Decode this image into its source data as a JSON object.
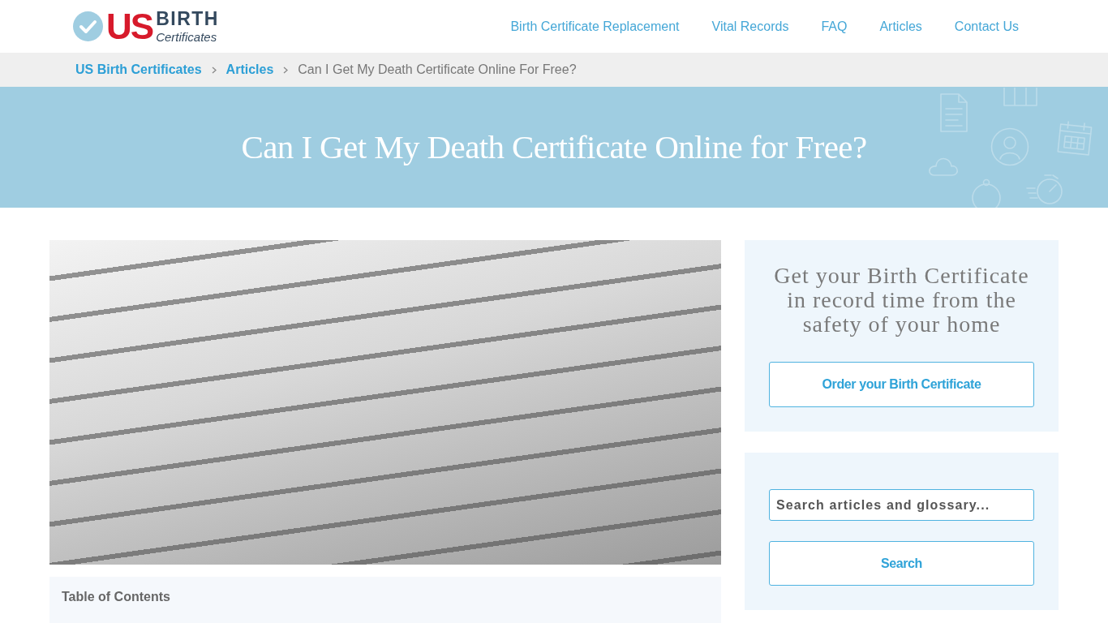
{
  "header": {
    "logo": {
      "mark": "US",
      "word": "BIRTH",
      "tagline": "Certificates"
    },
    "nav": [
      {
        "label": "Birth Certificate Replacement"
      },
      {
        "label": "Vital Records"
      },
      {
        "label": "FAQ"
      },
      {
        "label": "Articles"
      },
      {
        "label": "Contact Us"
      }
    ]
  },
  "breadcrumb": [
    {
      "label": "US Birth Certificates",
      "kind": "link"
    },
    {
      "label": "Articles",
      "kind": "link"
    },
    {
      "label": "Can I Get My Death Certificate Online For Free?",
      "kind": "current"
    }
  ],
  "hero": {
    "title": "Can I Get My Death Certificate Online for Free?"
  },
  "article": {
    "toc": {
      "title": "Table of Contents"
    }
  },
  "sidebar": {
    "promo": {
      "heading": "Get your Birth Certificate in record time from the safety of your home",
      "button": "Order your Birth Certificate"
    },
    "search": {
      "placeholder": "Search articles and glossary...",
      "button": "Search"
    }
  }
}
